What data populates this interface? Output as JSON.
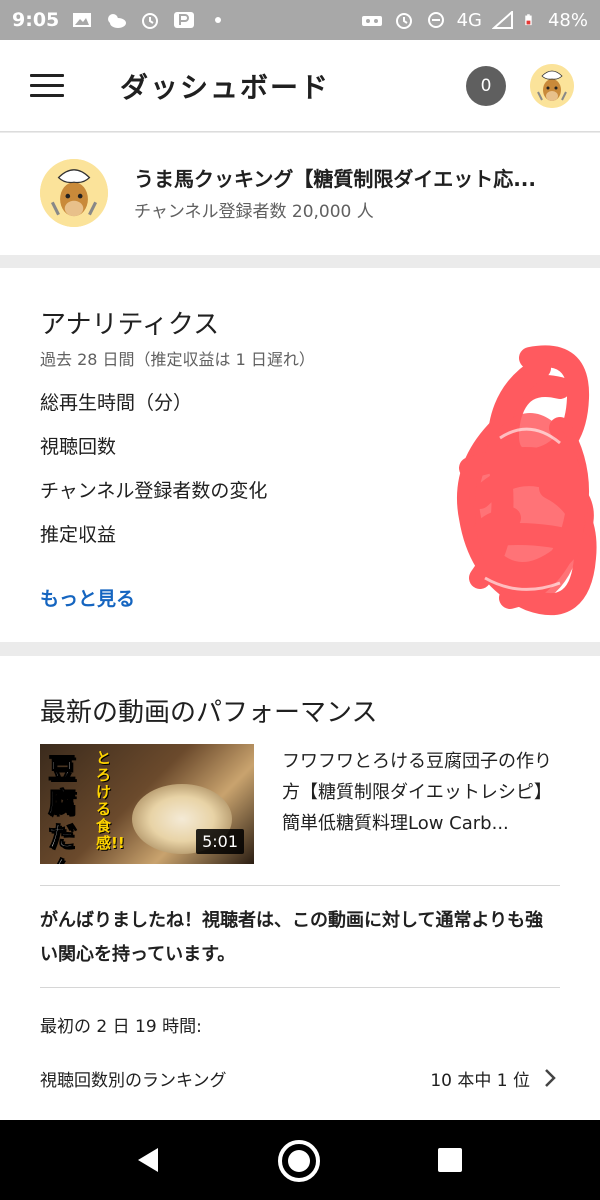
{
  "status_bar": {
    "time": "9:05",
    "network": "4G",
    "battery": "48%",
    "icons": [
      "image-icon",
      "weather-icon",
      "alarm-icon",
      "paypay-icon",
      "dot-icon",
      "vr-icon",
      "alarm-icon",
      "dnd-icon",
      "signal-icon",
      "battery-icon"
    ]
  },
  "app_bar": {
    "title": "ダッシュボード",
    "notification_count": "0"
  },
  "channel": {
    "name": "うま馬クッキング【糖質制限ダイエット応...",
    "subscribers": "チャンネル登録者数 20,000 人"
  },
  "analytics": {
    "title": "アナリティクス",
    "subtitle": "過去 28 日間（推定収益は 1 日遅れ）",
    "metrics": [
      "総再生時間（分）",
      "視聴回数",
      "チャンネル登録者数の変化",
      "推定収益"
    ],
    "more_label": "もっと見る",
    "scribble_color": "#ff5a5f"
  },
  "performance": {
    "title": "最新の動画のパフォーマンス",
    "video": {
      "thumbnail_title": "豆腐だんご",
      "thumbnail_subtitle": "とろける食感!!",
      "duration": "5:01",
      "title": "フワフワとろける豆腐団子の作り方【糖質制限ダイエットレシピ】簡単低糖質料理Low Carb..."
    },
    "praise": "がんばりましたね！視聴者は、この動画に対して通常よりも強い関心を持っています。",
    "first_period": "最初の 2 日 19 時間:",
    "ranking_label": "視聴回数別のランキング",
    "ranking_value": "10 本中 1 位"
  },
  "colors": {
    "accent_link": "#1565c0",
    "status_bar": "#a8a8a8",
    "badge": "#5f5f5f"
  }
}
